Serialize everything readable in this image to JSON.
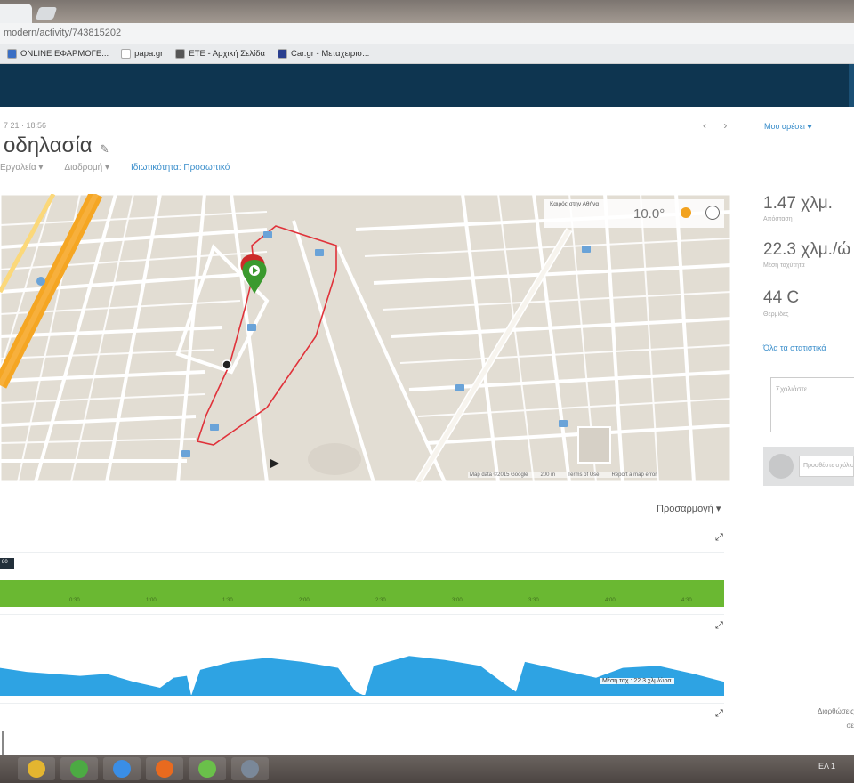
{
  "browser": {
    "url": "modern/activity/743815202",
    "bookmarks": [
      {
        "label": "ONLINE ΕΦΑΡΜΟΓΕ...",
        "color": "#3b6fc4"
      },
      {
        "label": "papa.gr",
        "color": "#ffffff"
      },
      {
        "label": "ΕΤΕ - Αρχική Σελίδα",
        "color": "#555555"
      },
      {
        "label": "Car.gr - Μεταχειρισ...",
        "color": "#2a3f8f"
      }
    ]
  },
  "activity": {
    "date": "7 21 · 18:56",
    "title": "οδηλασία",
    "subnav": [
      "Εργαλεία ▾",
      "Διαδρομή ▾",
      "Ιδιωτικότητα: Προσωπικό"
    ],
    "nav_arrows": "‹ ›"
  },
  "map": {
    "weather_location": "Καιρός στην Αθήνα",
    "temperature": "10.0°",
    "footer": [
      "Map data ©2015 Google",
      "200 m",
      "Terms of Use",
      "Report a map error"
    ]
  },
  "charts": {
    "options_label": "Προσαρμογή ▾",
    "hr_marker_label": "80",
    "green_ticks": [
      "0:30",
      "1:00",
      "1:30",
      "2:00",
      "2:30",
      "3:00",
      "3:30",
      "4:00",
      "4:30"
    ],
    "speed_label": "Μέση ταχ.: 22.3 χλμ/ώρα",
    "chart_data": {
      "type": "area",
      "title": "",
      "xlabel": "",
      "ylabel": "",
      "x": [
        0,
        30,
        60,
        90,
        120,
        150,
        180,
        195,
        210,
        215,
        225,
        260,
        300,
        340,
        380,
        400,
        410,
        420,
        460,
        500,
        540,
        570,
        580,
        590,
        610,
        640,
        670,
        700,
        740,
        780,
        814
      ],
      "series": [
        {
          "name": "",
          "values": [
            28,
            24,
            22,
            20,
            22,
            14,
            8,
            18,
            20,
            0,
            26,
            34,
            38,
            34,
            28,
            4,
            0,
            30,
            40,
            36,
            30,
            10,
            4,
            34,
            30,
            24,
            18,
            28,
            30,
            22,
            14
          ]
        }
      ],
      "ylim": [
        0,
        50
      ]
    }
  },
  "sidebar": {
    "top_link": "Μου αρέσει",
    "stats": [
      {
        "value": "1.47 χλμ.",
        "label": "Απόσταση"
      },
      {
        "value": "22.3 χλμ./ώ",
        "label": "Μέση ταχύτητα"
      },
      {
        "value": "44 C",
        "label": "Θερμίδες"
      }
    ],
    "more_link": "Όλα τα στατιστικά",
    "comment_placeholder": "Σχολιάστε",
    "share_placeholder": "Προσθέστε σχόλιο",
    "footer_line1": "Διορθώσεις",
    "footer_line2": "σε"
  },
  "taskbar": {
    "time": "ΕΛ 1",
    "apps": [
      {
        "name": "chrome",
        "color": "#e3b530"
      },
      {
        "name": "utorrent",
        "color": "#4caa43"
      },
      {
        "name": "ie",
        "color": "#3a8ee6"
      },
      {
        "name": "firefox",
        "color": "#e86a1f"
      },
      {
        "name": "utorrent2",
        "color": "#6ac04a"
      },
      {
        "name": "media",
        "color": "#7a8899"
      }
    ]
  }
}
